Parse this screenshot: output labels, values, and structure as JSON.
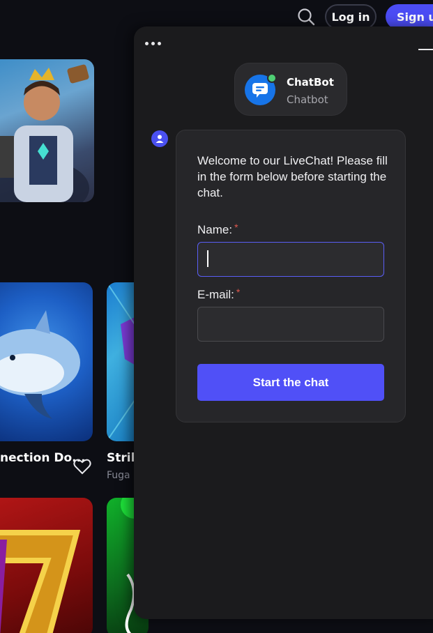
{
  "header": {
    "search_icon": "search-icon",
    "login_label": "Log in",
    "signup_label": "Sign up"
  },
  "games": [
    {
      "title": "nection Do...",
      "subtitle": ""
    },
    {
      "title": "Strik",
      "subtitle": "Fuga"
    }
  ],
  "chat": {
    "menu_icon": "more-horizontal-icon",
    "minimize_icon": "minimize-icon",
    "bot": {
      "name": "ChatBot",
      "role": "Chatbot",
      "status_color": "#4fcf74"
    },
    "form": {
      "welcome": "Welcome to our LiveChat! Please fill in the form below before starting the chat.",
      "name_label": "Name:",
      "email_label": "E-mail:",
      "required_mark": "*",
      "name_value": "",
      "email_value": "",
      "submit_label": "Start the chat"
    }
  },
  "colors": {
    "accent": "#5050f7",
    "panel_bg": "#1b1b1d",
    "card_bg": "#262629",
    "required": "#e0584e"
  }
}
